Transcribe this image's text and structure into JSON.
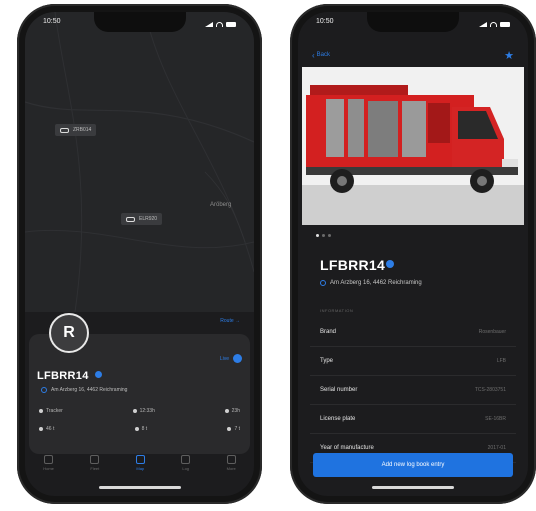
{
  "status_bar": {
    "time": "10:50"
  },
  "left_screen": {
    "map": {
      "tags": [
        "ZRB014",
        "ELR920"
      ],
      "place_label": "Aröberg"
    },
    "route_link": "Route →",
    "toggle_label": "Live",
    "vehicle": {
      "name": "LFBRR14",
      "address": "Am Arzberg 16, 4462 Reichraming",
      "meta": [
        "Trac­ker",
        "12:33h",
        "23h"
      ],
      "meta2": [
        "46 t",
        "8 t",
        "7 t"
      ]
    },
    "tabbar": [
      "Home",
      "Fleet",
      "Map",
      "Log",
      "More"
    ]
  },
  "right_screen": {
    "back_label": "Back",
    "title": "LFBRR14",
    "address": "Am Arzberg 16, 4462 Reichraming",
    "section_label": "INFORMATION",
    "properties": [
      {
        "key": "Brand",
        "value": "Rosenbauer"
      },
      {
        "key": "Type",
        "value": "LFB"
      },
      {
        "key": "Serial number",
        "value": "TCS-2803751"
      },
      {
        "key": "License plate",
        "value": "SE-16BR"
      },
      {
        "key": "Year of manufacture",
        "value": "2017-01"
      }
    ],
    "cta": "Add new log book entry",
    "carousel_count": 3,
    "carousel_active": 0
  },
  "colors": {
    "accent": "#1f73e0",
    "background": "#1c1c1e"
  }
}
